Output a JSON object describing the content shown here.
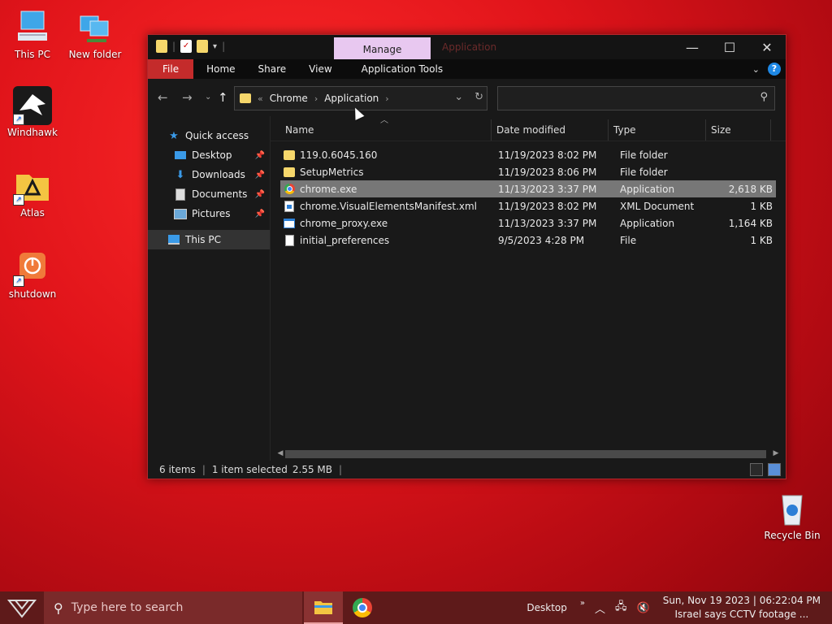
{
  "desktop": {
    "icons": [
      {
        "label": "This PC"
      },
      {
        "label": "New folder"
      },
      {
        "label": "Windhawk"
      },
      {
        "label": "Atlas"
      },
      {
        "label": "shutdown"
      },
      {
        "label": "Recycle Bin"
      }
    ]
  },
  "window": {
    "contextual_tab": "Manage",
    "title": "Application",
    "ribbon_tabs": [
      "File",
      "Home",
      "Share",
      "View",
      "Application Tools"
    ],
    "address": {
      "overflow": "«",
      "crumbs": [
        "Chrome",
        "Application"
      ]
    },
    "search": {
      "placeholder": ""
    },
    "nav_pane": {
      "items": [
        {
          "label": "Quick access",
          "icon": "star-icon"
        },
        {
          "label": "Desktop",
          "icon": "desktop-icon",
          "pinned": true
        },
        {
          "label": "Downloads",
          "icon": "download-icon",
          "pinned": true
        },
        {
          "label": "Documents",
          "icon": "documents-icon",
          "pinned": true
        },
        {
          "label": "Pictures",
          "icon": "pictures-icon",
          "pinned": true
        },
        {
          "label": "This PC",
          "icon": "computer-icon",
          "selected": true
        }
      ]
    },
    "columns": [
      "Name",
      "Date modified",
      "Type",
      "Size"
    ],
    "files": [
      {
        "name": "119.0.6045.160",
        "date": "11/19/2023 8:02 PM",
        "type": "File folder",
        "size": "",
        "icon": "folder-icon"
      },
      {
        "name": "SetupMetrics",
        "date": "11/19/2023 8:06 PM",
        "type": "File folder",
        "size": "",
        "icon": "folder-icon"
      },
      {
        "name": "chrome.exe",
        "date": "11/13/2023 3:37 PM",
        "type": "Application",
        "size": "2,618 KB",
        "icon": "chrome-icon",
        "selected": true
      },
      {
        "name": "chrome.VisualElementsManifest.xml",
        "date": "11/19/2023 8:02 PM",
        "type": "XML Document",
        "size": "1 KB",
        "icon": "xml-file-icon"
      },
      {
        "name": "chrome_proxy.exe",
        "date": "11/13/2023 3:37 PM",
        "type": "Application",
        "size": "1,164 KB",
        "icon": "exe-icon"
      },
      {
        "name": "initial_preferences",
        "date": "9/5/2023 4:28 PM",
        "type": "File",
        "size": "1 KB",
        "icon": "file-icon"
      }
    ],
    "status": {
      "items": "6 items",
      "selection": "1 item selected",
      "selection_size": "2.55 MB"
    }
  },
  "taskbar": {
    "search_placeholder": "Type here to search",
    "desktop_label": "Desktop",
    "clock_line1": "Sun, Nov 19 2023 | 06:22:04 PM",
    "clock_line2": "Israel says CCTV footage ..."
  },
  "colors": {
    "accent_red": "#c42b2b",
    "manage_tab": "#e8c8f0",
    "selection": "#777777"
  }
}
